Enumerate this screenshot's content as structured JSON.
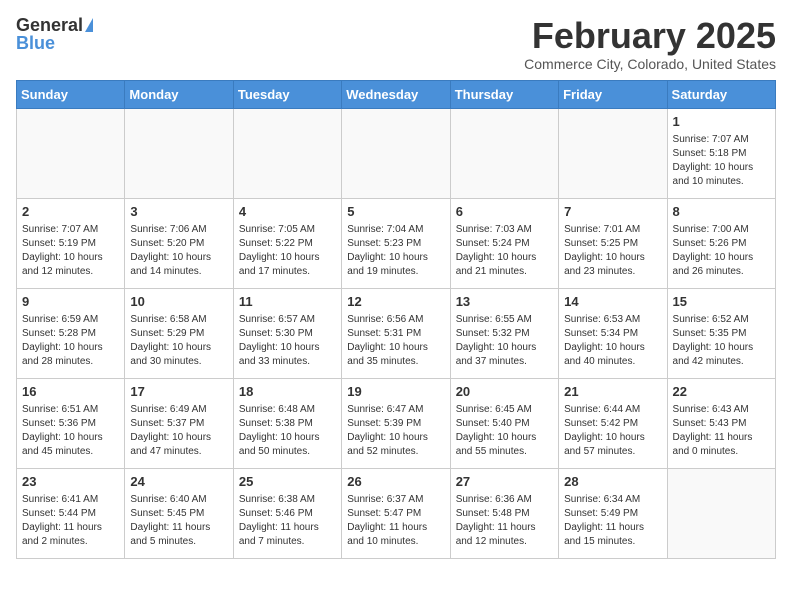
{
  "header": {
    "logo_general": "General",
    "logo_blue": "Blue",
    "month_title": "February 2025",
    "subtitle": "Commerce City, Colorado, United States"
  },
  "weekdays": [
    "Sunday",
    "Monday",
    "Tuesday",
    "Wednesday",
    "Thursday",
    "Friday",
    "Saturday"
  ],
  "weeks": [
    [
      {
        "day": "",
        "info": ""
      },
      {
        "day": "",
        "info": ""
      },
      {
        "day": "",
        "info": ""
      },
      {
        "day": "",
        "info": ""
      },
      {
        "day": "",
        "info": ""
      },
      {
        "day": "",
        "info": ""
      },
      {
        "day": "1",
        "info": "Sunrise: 7:07 AM\nSunset: 5:18 PM\nDaylight: 10 hours and 10 minutes."
      }
    ],
    [
      {
        "day": "2",
        "info": "Sunrise: 7:07 AM\nSunset: 5:19 PM\nDaylight: 10 hours and 12 minutes."
      },
      {
        "day": "3",
        "info": "Sunrise: 7:06 AM\nSunset: 5:20 PM\nDaylight: 10 hours and 14 minutes."
      },
      {
        "day": "4",
        "info": "Sunrise: 7:05 AM\nSunset: 5:22 PM\nDaylight: 10 hours and 17 minutes."
      },
      {
        "day": "5",
        "info": "Sunrise: 7:04 AM\nSunset: 5:23 PM\nDaylight: 10 hours and 19 minutes."
      },
      {
        "day": "6",
        "info": "Sunrise: 7:03 AM\nSunset: 5:24 PM\nDaylight: 10 hours and 21 minutes."
      },
      {
        "day": "7",
        "info": "Sunrise: 7:01 AM\nSunset: 5:25 PM\nDaylight: 10 hours and 23 minutes."
      },
      {
        "day": "8",
        "info": "Sunrise: 7:00 AM\nSunset: 5:26 PM\nDaylight: 10 hours and 26 minutes."
      }
    ],
    [
      {
        "day": "9",
        "info": "Sunrise: 6:59 AM\nSunset: 5:28 PM\nDaylight: 10 hours and 28 minutes."
      },
      {
        "day": "10",
        "info": "Sunrise: 6:58 AM\nSunset: 5:29 PM\nDaylight: 10 hours and 30 minutes."
      },
      {
        "day": "11",
        "info": "Sunrise: 6:57 AM\nSunset: 5:30 PM\nDaylight: 10 hours and 33 minutes."
      },
      {
        "day": "12",
        "info": "Sunrise: 6:56 AM\nSunset: 5:31 PM\nDaylight: 10 hours and 35 minutes."
      },
      {
        "day": "13",
        "info": "Sunrise: 6:55 AM\nSunset: 5:32 PM\nDaylight: 10 hours and 37 minutes."
      },
      {
        "day": "14",
        "info": "Sunrise: 6:53 AM\nSunset: 5:34 PM\nDaylight: 10 hours and 40 minutes."
      },
      {
        "day": "15",
        "info": "Sunrise: 6:52 AM\nSunset: 5:35 PM\nDaylight: 10 hours and 42 minutes."
      }
    ],
    [
      {
        "day": "16",
        "info": "Sunrise: 6:51 AM\nSunset: 5:36 PM\nDaylight: 10 hours and 45 minutes."
      },
      {
        "day": "17",
        "info": "Sunrise: 6:49 AM\nSunset: 5:37 PM\nDaylight: 10 hours and 47 minutes."
      },
      {
        "day": "18",
        "info": "Sunrise: 6:48 AM\nSunset: 5:38 PM\nDaylight: 10 hours and 50 minutes."
      },
      {
        "day": "19",
        "info": "Sunrise: 6:47 AM\nSunset: 5:39 PM\nDaylight: 10 hours and 52 minutes."
      },
      {
        "day": "20",
        "info": "Sunrise: 6:45 AM\nSunset: 5:40 PM\nDaylight: 10 hours and 55 minutes."
      },
      {
        "day": "21",
        "info": "Sunrise: 6:44 AM\nSunset: 5:42 PM\nDaylight: 10 hours and 57 minutes."
      },
      {
        "day": "22",
        "info": "Sunrise: 6:43 AM\nSunset: 5:43 PM\nDaylight: 11 hours and 0 minutes."
      }
    ],
    [
      {
        "day": "23",
        "info": "Sunrise: 6:41 AM\nSunset: 5:44 PM\nDaylight: 11 hours and 2 minutes."
      },
      {
        "day": "24",
        "info": "Sunrise: 6:40 AM\nSunset: 5:45 PM\nDaylight: 11 hours and 5 minutes."
      },
      {
        "day": "25",
        "info": "Sunrise: 6:38 AM\nSunset: 5:46 PM\nDaylight: 11 hours and 7 minutes."
      },
      {
        "day": "26",
        "info": "Sunrise: 6:37 AM\nSunset: 5:47 PM\nDaylight: 11 hours and 10 minutes."
      },
      {
        "day": "27",
        "info": "Sunrise: 6:36 AM\nSunset: 5:48 PM\nDaylight: 11 hours and 12 minutes."
      },
      {
        "day": "28",
        "info": "Sunrise: 6:34 AM\nSunset: 5:49 PM\nDaylight: 11 hours and 15 minutes."
      },
      {
        "day": "",
        "info": ""
      }
    ]
  ]
}
